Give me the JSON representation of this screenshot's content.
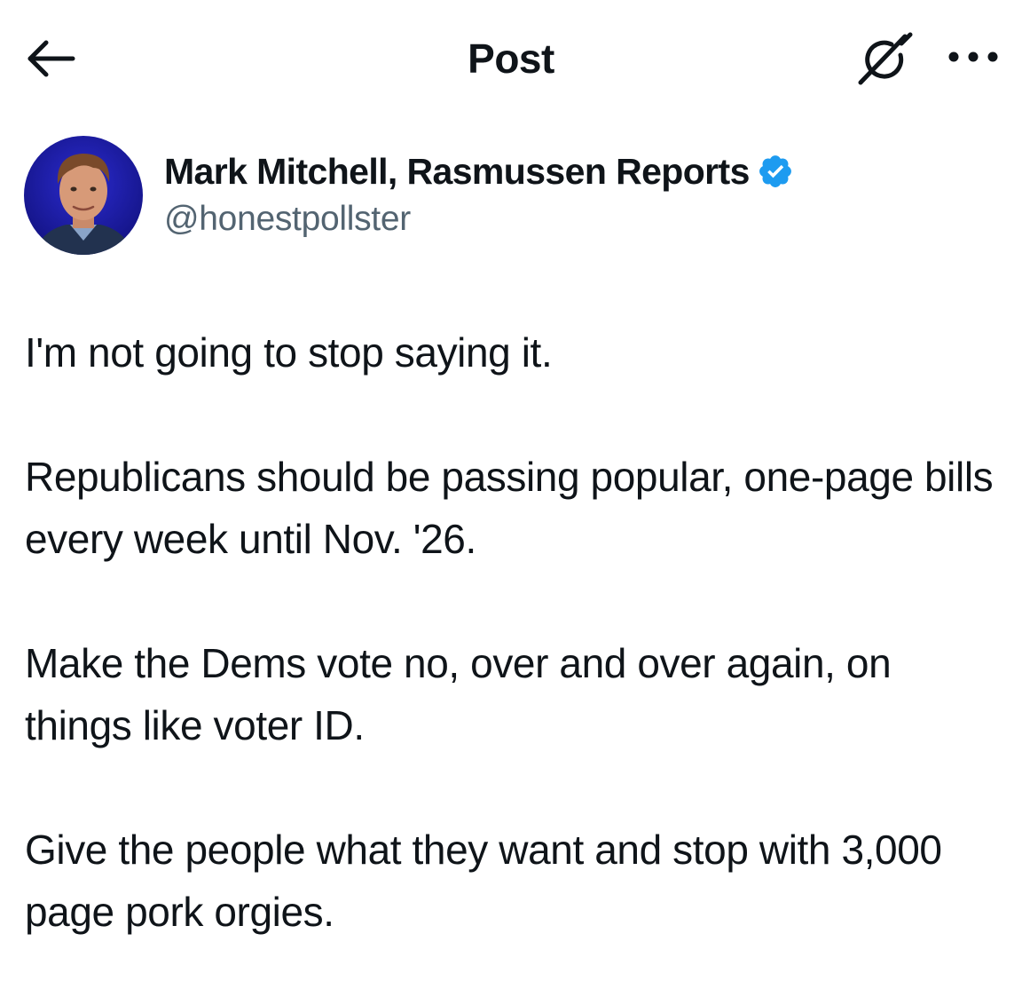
{
  "header": {
    "title": "Post",
    "back_icon": "arrow-left-icon",
    "grok_icon": "grok-slash-circle-icon",
    "more_icon": "ellipsis-icon"
  },
  "author": {
    "display_name": "Mark Mitchell, Rasmussen Reports",
    "handle": "@honestpollster",
    "verified": true,
    "verified_color": "#1d9bf0",
    "avatar_background": "#1a1aa8"
  },
  "post": {
    "paragraphs": [
      "I'm not going to stop saying it.",
      "Republicans should be passing popular, one-page bills every week until Nov. '26.",
      "Make the Dems vote no, over and over again, on things like voter ID.",
      "Give the people what they want and stop with 3,000 page pork orgies."
    ]
  }
}
